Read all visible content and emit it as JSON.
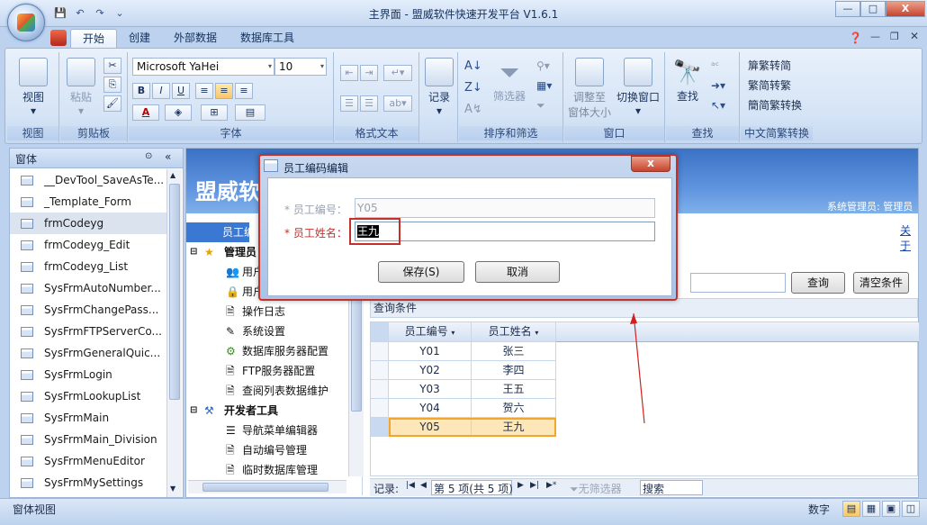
{
  "window": {
    "title": "主界面 - 盟威软件快速开发平台 V1.6.1",
    "min": "—",
    "max": "□",
    "close": "X"
  },
  "qat": {
    "save": "💾",
    "undo": "↶",
    "redo": "↷",
    "more": "⌄"
  },
  "tabs": [
    "开始",
    "创建",
    "外部数据",
    "数据库工具"
  ],
  "ribbon": {
    "view": {
      "label": "视图",
      "group": "视图"
    },
    "clipboard": {
      "paste": "粘贴",
      "group": "剪贴板"
    },
    "font": {
      "family": "Microsoft YaHei",
      "size": "10",
      "bold": "B",
      "italic": "I",
      "underline": "U",
      "color": "A",
      "group": "字体"
    },
    "format": {
      "group": "格式文本"
    },
    "records": {
      "label": "记录"
    },
    "sort": {
      "filter": "筛选器",
      "group": "排序和筛选"
    },
    "window": {
      "resize1": "调整至",
      "resize2": "窗体大小",
      "switch": "切换窗口",
      "group": "窗口"
    },
    "find": {
      "label": "查找",
      "group": "查找"
    },
    "chinese": {
      "t2s": "繁转简",
      "s2t": "简转繁",
      "conv": "简繁转换",
      "group": "中文简繁转换"
    }
  },
  "nav": {
    "title": "窗体",
    "items": [
      "__DevTool_SaveAsTe...",
      "_Template_Form",
      "frmCodeyg",
      "frmCodeyg_Edit",
      "frmCodeyg_List",
      "SysFrmAutoNumber...",
      "SysFrmChangePass...",
      "SysFrmFTPServerCo...",
      "SysFrmGeneralQuic...",
      "SysFrmLogin",
      "SysFrmLookupList",
      "SysFrmMain",
      "SysFrmMain_Division",
      "SysFrmMenuEditor",
      "SysFrmMySettings"
    ]
  },
  "banner": {
    "brand": "盟威软",
    "user": "系统管理员: 管理员",
    "about": "关于"
  },
  "tree": {
    "emp_code": "员工编",
    "mgr": "管理员",
    "user1": "用户",
    "user2": "用户",
    "log": "操作日志",
    "settings": "系统设置",
    "db_server": "数据库服务器配置",
    "ftp": "FTP服务器配置",
    "list_maint": "查阅列表数据维护",
    "dev": "开发者工具",
    "nav_menu": "导航菜单编辑器",
    "autonum": "自动编号管理",
    "tempdb": "临时数据库管理"
  },
  "query": {
    "condition": "查询条件",
    "query_btn": "查询",
    "clear_btn": "清空条件"
  },
  "grid": {
    "headers": [
      "员工编号",
      "员工姓名"
    ],
    "rows": [
      [
        "Y01",
        "张三"
      ],
      [
        "Y02",
        "李四"
      ],
      [
        "Y03",
        "王五"
      ],
      [
        "Y04",
        "贺六"
      ],
      [
        "Y05",
        "王九"
      ]
    ]
  },
  "recnav": {
    "label": "记录:",
    "pos": "第 5 项(共 5 项)",
    "nofilter": "无筛选器",
    "search": "搜索"
  },
  "status": {
    "left": "窗体视图",
    "num": "数字"
  },
  "dialog": {
    "title": "员工编码编辑",
    "code_label": "* 员工编号：",
    "code_value": "Y05",
    "name_label": "* 员工姓名：",
    "name_value": "王九",
    "save": "保存(S)",
    "cancel": "取消",
    "close": "x"
  },
  "colors": {
    "accent": "#c4302b",
    "banner": "#3c72c4",
    "selected_row": "#fde7b8"
  }
}
